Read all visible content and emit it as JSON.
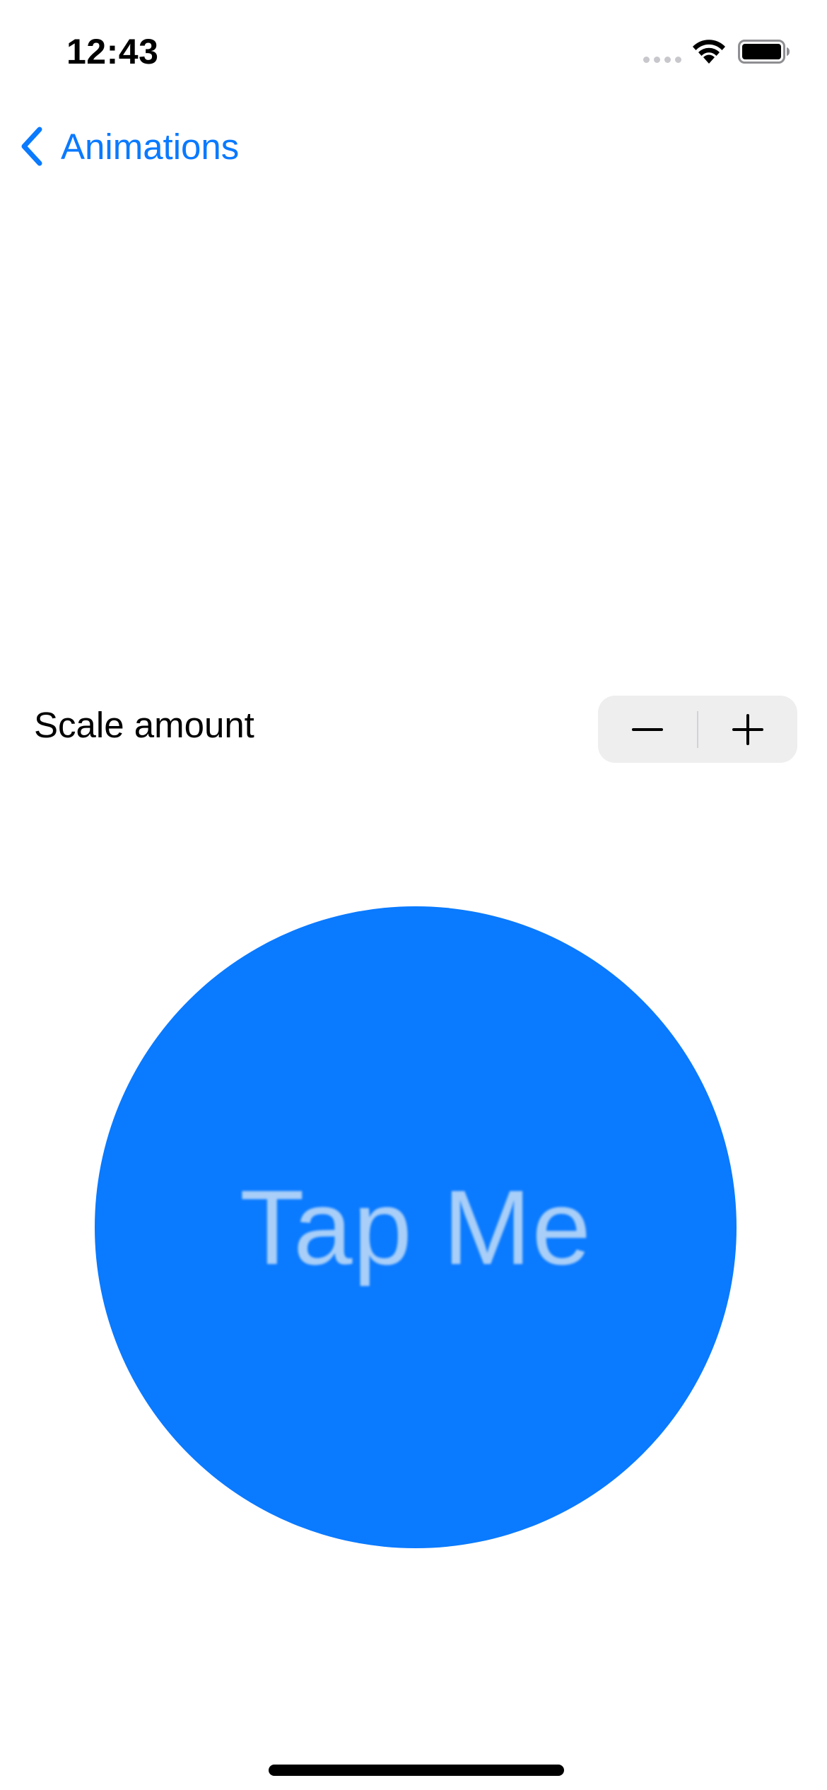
{
  "status_bar": {
    "time": "12:43",
    "icons": [
      "signal-dots-icon",
      "wifi-icon",
      "battery-icon"
    ]
  },
  "nav": {
    "back_label": "Animations",
    "back_icon": "chevron-left-icon"
  },
  "stepper": {
    "label": "Scale amount",
    "decrement_icon": "minus-icon",
    "increment_icon": "plus-icon"
  },
  "circle_button": {
    "label": "Tap Me"
  },
  "colors": {
    "accent": "#0a7aff",
    "circle_text": "#a9cff8",
    "stepper_bg": "#eeeeef"
  }
}
